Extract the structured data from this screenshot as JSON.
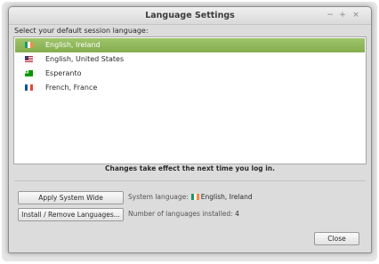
{
  "window": {
    "title": "Language Settings",
    "minimize": "−",
    "maximize": "+",
    "close": "×"
  },
  "prompt": "Select your default session language:",
  "languages": [
    {
      "label": "English, Ireland",
      "flag": "flag-ireland-icon",
      "selected": true
    },
    {
      "label": "English, United States",
      "flag": "flag-usa-icon",
      "selected": false
    },
    {
      "label": "Esperanto",
      "flag": "flag-esperanto-icon",
      "selected": false
    },
    {
      "label": "French, France",
      "flag": "flag-france-icon",
      "selected": false
    }
  ],
  "note": "Changes take effect the next time you log in.",
  "buttons": {
    "apply": "Apply System Wide",
    "install": "Install / Remove Languages...",
    "close": "Close"
  },
  "system_language": {
    "label": "System language:",
    "value": "English, Ireland"
  },
  "installed": {
    "label": "Number of languages installed:",
    "value": "4"
  },
  "colors": {
    "selection": "#8fb65a",
    "window": "#dcdcdc"
  }
}
